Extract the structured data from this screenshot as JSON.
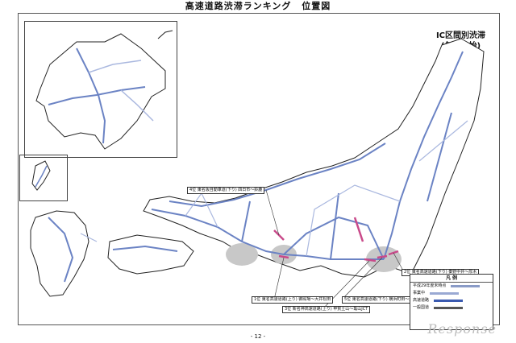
{
  "header": {
    "title": "高速道路渋滞ランキング",
    "subtitle": "位置図"
  },
  "corner_note": {
    "line1": "IC区間別渋滞",
    "line2": "(年末年始)"
  },
  "callouts": [
    {
      "rank": "3位",
      "text": "3位 新名神高速道路(上り) 甲賀土山～亀山JCT"
    },
    {
      "rank": "5位",
      "text": "5位 東名高速道路(下り) 横浜町田～海老名JCT"
    },
    {
      "rank": "4位",
      "text": "4位 東名阪自動車道(下り) 四日市～鈴鹿"
    },
    {
      "rank": "1位",
      "text": "1位 東名高速道路(上り) 御殿場～大井松田"
    },
    {
      "rank": "2位",
      "text": "2位 東名高速道路(下り) 秦野中井～厚木"
    }
  ],
  "legend": {
    "title": "凡 例",
    "rows": [
      {
        "label": "平成29年度末時点",
        "color": "#8a9bc7"
      },
      {
        "label": "事業中",
        "color": "#9aa9d3"
      },
      {
        "label": "高速道路",
        "color": "#3a5ab0"
      },
      {
        "label": "一般国道",
        "color": "#555555"
      }
    ]
  },
  "page_number": "- 12 -",
  "watermark": "Response",
  "colors": {
    "expressway": "#6b83c4",
    "expressway_light": "#aab8df",
    "congestion": "#c94a8a",
    "urban_shade": "#c8c8c8",
    "coast": "#222222"
  }
}
